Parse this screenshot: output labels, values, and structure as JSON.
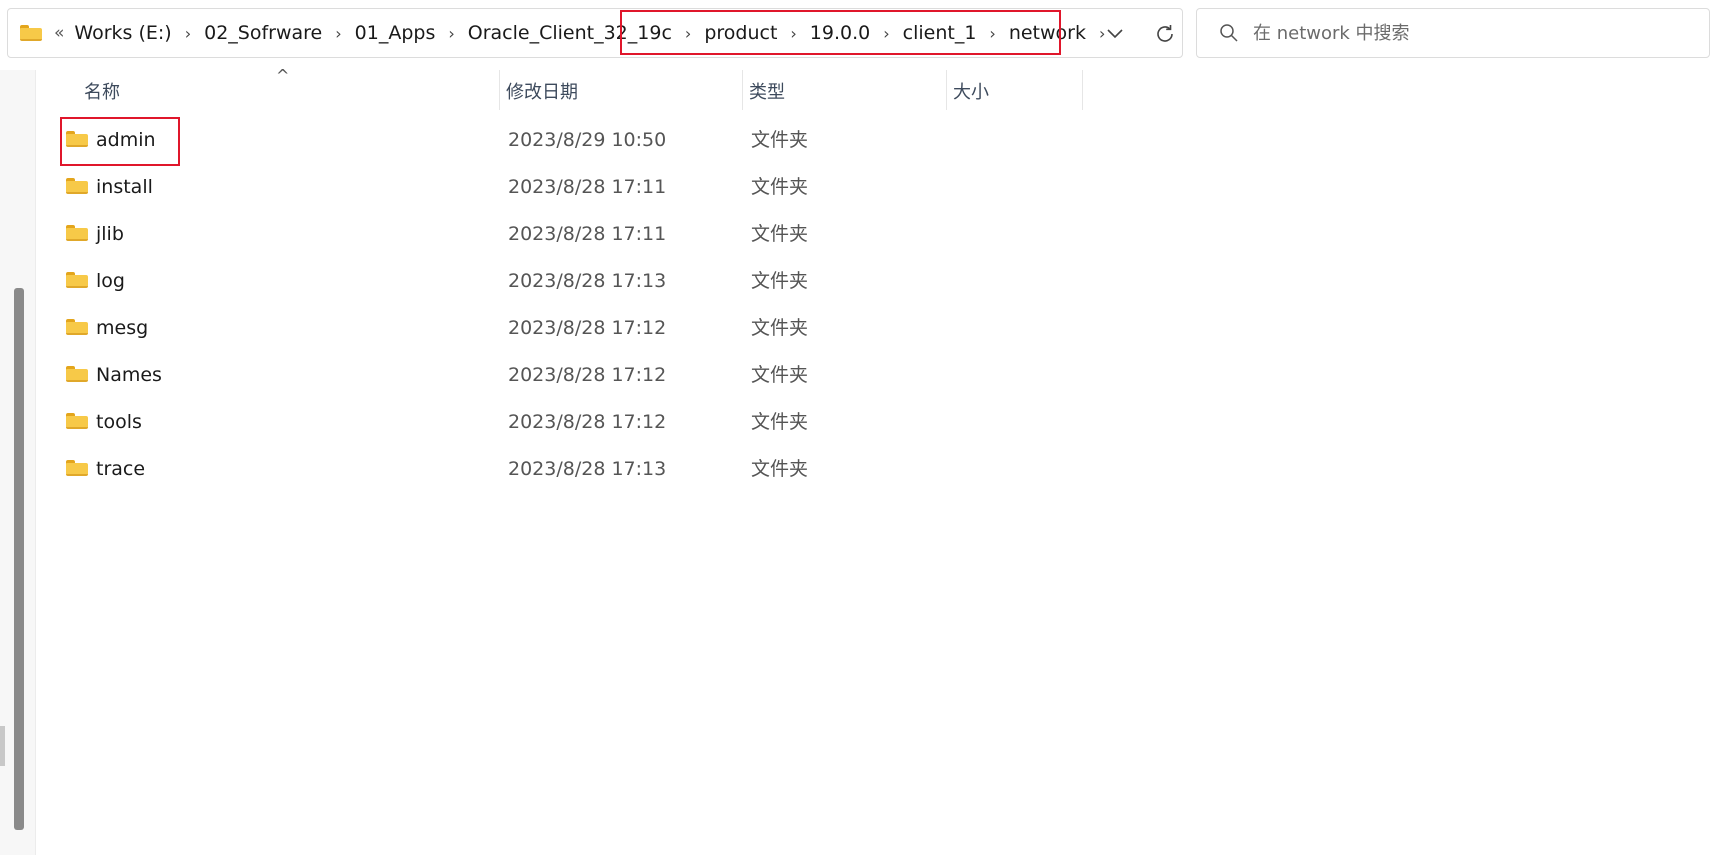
{
  "address_bar": {
    "overflow_glyph": "«",
    "separator_glyph": "›",
    "crumbs": [
      "Works (E:)",
      "02_Sofrware",
      "01_Apps",
      "Oracle_Client_32_19c",
      "product",
      "19.0.0",
      "client_1",
      "network"
    ],
    "dropdown_icon": "chevron-down-icon",
    "refresh_icon": "refresh-icon"
  },
  "search": {
    "placeholder": "在 network 中搜索",
    "value": ""
  },
  "columns": {
    "name": "名称",
    "date": "修改日期",
    "type": "类型",
    "size": "大小",
    "sort_glyph": "^"
  },
  "files": [
    {
      "name": "admin",
      "date": "2023/8/29 10:50",
      "type": "文件夹"
    },
    {
      "name": "install",
      "date": "2023/8/28 17:11",
      "type": "文件夹"
    },
    {
      "name": "jlib",
      "date": "2023/8/28 17:11",
      "type": "文件夹"
    },
    {
      "name": "log",
      "date": "2023/8/28 17:13",
      "type": "文件夹"
    },
    {
      "name": "mesg",
      "date": "2023/8/28 17:12",
      "type": "文件夹"
    },
    {
      "name": "Names",
      "date": "2023/8/28 17:12",
      "type": "文件夹"
    },
    {
      "name": "tools",
      "date": "2023/8/28 17:12",
      "type": "文件夹"
    },
    {
      "name": "trace",
      "date": "2023/8/28 17:13",
      "type": "文件夹"
    }
  ],
  "colors": {
    "folder": "#f7c948",
    "highlight": "#e0162b"
  }
}
